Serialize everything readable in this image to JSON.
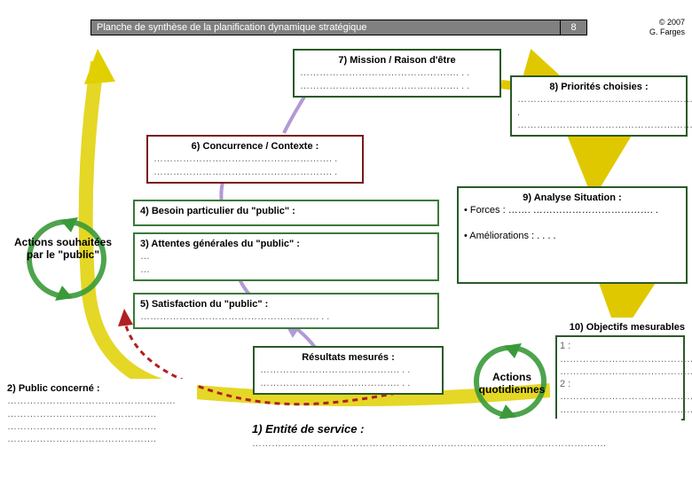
{
  "header": {
    "title": "Planche de synthèse de la planification dynamique stratégique",
    "num": "8"
  },
  "copyright": {
    "line1": "© 2007",
    "line2": "G. Farges"
  },
  "box7": {
    "title": "7) Mission / Raison d'être",
    "dots1": "…………………………………………. . .",
    "dots2": "…………………………………………. . ."
  },
  "box8": {
    "title": "8) Priorités choisies :",
    "dots1": "…………………………………………………. .",
    "dots2": "…………………………………………………"
  },
  "box6": {
    "title": "6) Concurrence / Contexte :",
    "dots1": "………………………………………………. .",
    "dots2": "………………………………………………. ."
  },
  "box4": {
    "title": "4) Besoin particulier du \"public\" :"
  },
  "box3": {
    "title": "3) Attentes générales du \"public\" :",
    "dots1": "…",
    "dots2": "…"
  },
  "box5": {
    "title": "5) Satisfaction du \"public\" :",
    "dots": "………………………………………………. . ."
  },
  "box9": {
    "title": "9) Analyse Situation :",
    "forces": "• Forces : ……. ………………………………. .",
    "amel": "• Améliorations : . . . ."
  },
  "box10": {
    "title": "10) Objectifs mesurables",
    "l1": "1 : ……………………………………",
    "l2": "…………………………………………",
    "l3": "2 : ……………………………………",
    "l4": "…………………………………………"
  },
  "boxRes": {
    "title": "Résultats mesurés :",
    "dots1": "……………………………………. . .",
    "dots2": "……………………………………. . ."
  },
  "box2": {
    "title": "2) Public concerné :",
    "dots": "……………………………………….……\n……………………………………….\n……………………………………….\n………………………………………."
  },
  "box1": {
    "title": "1) Entité de service :",
    "dots": "………………………………………………………………………………………………."
  },
  "sideLeft": "Actions souhaitées par le \"public\"",
  "sideRight": "Actions quotidiennes"
}
